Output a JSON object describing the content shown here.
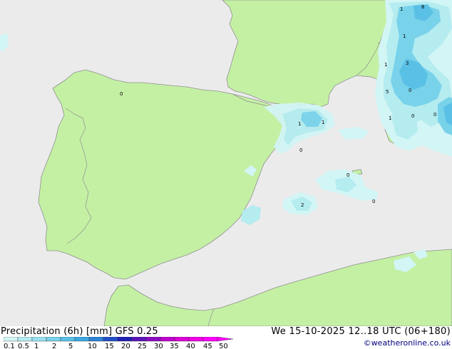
{
  "header": {
    "title": "Precipitation (6h) [mm] GFS 0.25",
    "valid": "We 15-10-2025 12..18 UTC (06+180)",
    "credit": "©weatheronline.co.uk"
  },
  "colors": {
    "sea": "#ebebeb",
    "land": "#c4f0a4",
    "border": "#8f8f8f",
    "precip_scale": [
      "#d2f5f5",
      "#b4ecf0",
      "#96e1ed",
      "#78d2ea",
      "#5ac0e6",
      "#3ca8e1",
      "#2d82d7",
      "#2050c8",
      "#2020b4",
      "#5a14b9",
      "#8c0ac3",
      "#be00cd",
      "#dc00d7",
      "#f000e6",
      "#ff00ff"
    ]
  },
  "legend": {
    "ticks": [
      "0.1",
      "0.5",
      "1",
      "2",
      "5",
      "10",
      "15",
      "20",
      "25",
      "30",
      "35",
      "40",
      "45",
      "50"
    ]
  },
  "map_values": [
    {
      "label": "0",
      "id": "madrid-area"
    },
    {
      "label": "1",
      "id": "catalonia-1"
    },
    {
      "label": "1",
      "id": "catalonia-2"
    },
    {
      "label": "0",
      "id": "delta-ebro"
    },
    {
      "label": "0",
      "id": "mallorca"
    },
    {
      "label": "2",
      "id": "valencia-sea"
    },
    {
      "label": "0",
      "id": "balearic-east"
    },
    {
      "label": "1",
      "id": "alps-1"
    },
    {
      "label": "8",
      "id": "alps-2"
    },
    {
      "label": "1",
      "id": "alps-3"
    },
    {
      "label": "1",
      "id": "italy-1"
    },
    {
      "label": "3",
      "id": "italy-2"
    },
    {
      "label": "5",
      "id": "corsica"
    },
    {
      "label": "0",
      "id": "ligurian"
    },
    {
      "label": "1",
      "id": "sardinia-1"
    },
    {
      "label": "0",
      "id": "sardinia-2"
    },
    {
      "label": "0",
      "id": "tyrrhenian"
    }
  ]
}
